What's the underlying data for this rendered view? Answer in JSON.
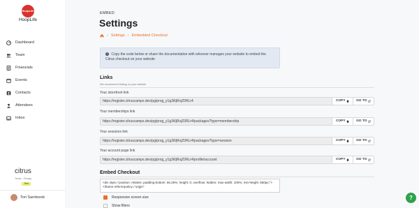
{
  "brand": {
    "logo_text": "HoopLife",
    "name": "HoopLife"
  },
  "nav": {
    "items": [
      {
        "label": "Dashboard",
        "icon": "dashboard-icon"
      },
      {
        "label": "Team",
        "icon": "team-icon"
      },
      {
        "label": "Financials",
        "icon": "financials-icon"
      },
      {
        "label": "Events",
        "icon": "events-icon"
      },
      {
        "label": "Contacts",
        "icon": "contacts-icon"
      },
      {
        "label": "Attendees",
        "icon": "attendees-icon"
      },
      {
        "label": "Inbox",
        "icon": "inbox-icon"
      }
    ]
  },
  "footer": {
    "logo": "citrus",
    "terms": "Terms",
    "dot": "·",
    "privacy": "Privacy",
    "badge": "Test"
  },
  "user": {
    "name": "Tori Samborsk"
  },
  "page": {
    "eyebrow": "EMBED",
    "title": "Settings",
    "breadcrumb": {
      "home_icon": "home-icon",
      "items": [
        "Settings",
        "Embedded Checkout"
      ],
      "sep": "›"
    },
    "info": "Copy the code below or share the documentation with whoever manages your website to embed the Citrus checkout on your website"
  },
  "links": {
    "title": "Links",
    "subtitle": "We recommend linking on your website",
    "copy_label": "COPY",
    "goto_label": "GO TO",
    "fields": [
      {
        "label": "Your storefront link",
        "value": "https://register.citruscamps.dev/pg/prog_y1g3i6jRvjZ0RLr4"
      },
      {
        "label": "Your memberships link",
        "value": "https://register.citruscamps.dev/pg/prog_y1g3i6jRvjZ0RLr4/packages?type=membership"
      },
      {
        "label": "Your sessions link",
        "value": "https://register.citruscamps.dev/pg/prog_y1g3i6jRvjZ0RLr4/packages?type=session"
      },
      {
        "label": "Your account page link",
        "value": "https://register.citruscamps.dev/pg/prog_y1g3i6jRvjZ0RLr4/profile/account"
      }
    ]
  },
  "embed": {
    "title": "Embed Checkout",
    "code": "<div style=\"position: relative; padding-bottom: 56.25%; height: 0; overflow: hidden; max-width: 100%; min-height: 550px;\"><iframe referrerpolicy=\"origin\"",
    "options": [
      {
        "label": "Responsive screen size",
        "checked": true
      },
      {
        "label": "Show filters",
        "checked": false
      }
    ]
  },
  "help": {
    "label": "?"
  },
  "colors": {
    "accent": "#e8702a",
    "brand": "#d9322b",
    "help": "#2fa14c"
  }
}
